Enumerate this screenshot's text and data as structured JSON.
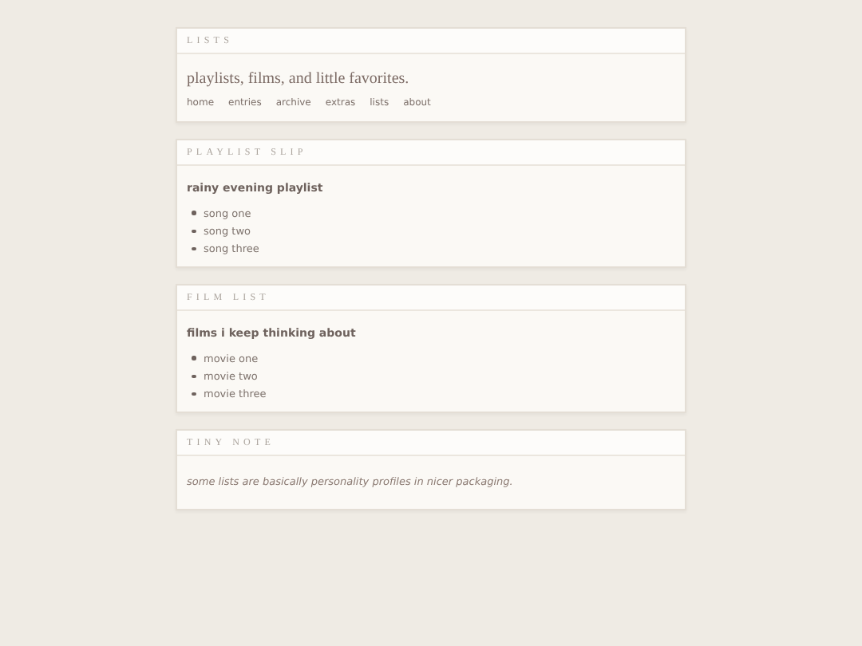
{
  "panels": [
    {
      "kind": "intro",
      "heading": "LISTS",
      "tagline": "playlists, films, and little favorites.",
      "nav": [
        "home",
        "entries",
        "archive",
        "extras",
        "lists",
        "about"
      ]
    },
    {
      "kind": "list",
      "heading": "PLAYLIST SLIP",
      "title": "rainy evening playlist",
      "items": [
        "song one",
        "song two",
        "song three"
      ]
    },
    {
      "kind": "list",
      "heading": "FILM LIST",
      "title": "films i keep thinking about",
      "items": [
        "movie one",
        "movie two",
        "movie three"
      ]
    },
    {
      "kind": "note",
      "heading": "TINY NOTE",
      "text": "some lists are basically personality profiles in nicer packaging."
    }
  ]
}
